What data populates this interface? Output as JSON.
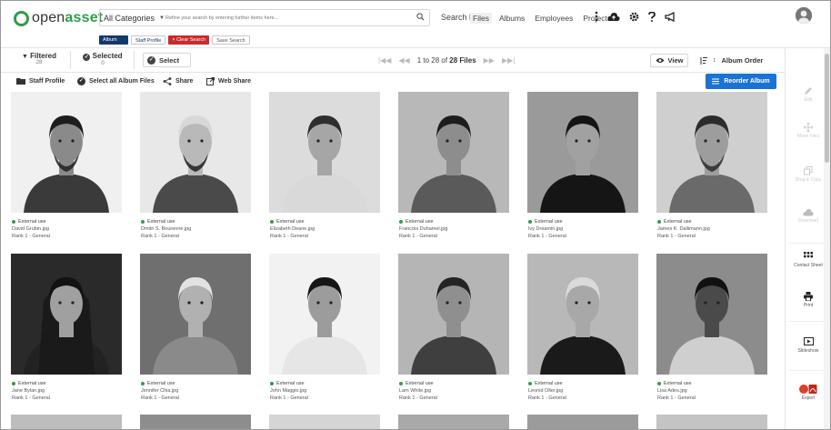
{
  "header": {
    "logo": {
      "brand_prefix": "open",
      "brand_suffix": "asset"
    },
    "category": "All Categories",
    "search_placeholder": "Refine your search by entering further items here...",
    "search_by": "Search by",
    "chips": [
      "Album",
      "Staff Profile",
      "× Clear Search",
      "Save Search"
    ],
    "nav": [
      "Files",
      "Albums",
      "Employees",
      "Projects"
    ],
    "nav_active": "Files"
  },
  "toolbar": {
    "filtered_label": "Filtered",
    "filtered_count": "28",
    "selected_label": "Selected",
    "selected_count": "0",
    "select_label": "Select",
    "pager_text": "1 to 28 of",
    "pager_bold": "28 Files",
    "view_label": "View",
    "order_label": "Album Order"
  },
  "actions": {
    "staff_profile": "Staff Profile",
    "select_all": "Select all Album Files",
    "share": "Share",
    "web_share": "Web Share",
    "reorder": "Reorder Album"
  },
  "sidebar": {
    "items": [
      {
        "label": "Edit",
        "icon": "pencil-icon",
        "dim": true
      },
      {
        "label": "Move Files",
        "icon": "move-icon",
        "dim": true
      },
      {
        "label": "Drag & Copy",
        "icon": "copy-icon",
        "dim": true
      },
      {
        "label": "Download",
        "icon": "cloud-download-icon",
        "dim": true
      },
      {
        "label": "Contact Sheet",
        "icon": "grid-icon",
        "dim": false
      },
      {
        "label": "Print",
        "icon": "print-icon",
        "dim": false
      },
      {
        "label": "Slideshow",
        "icon": "slideshow-icon",
        "dim": false
      },
      {
        "label": "Export",
        "icon": "export-icon",
        "dim": false
      }
    ]
  },
  "files": [
    {
      "usage": "External use",
      "name": "David Grubin.jpg",
      "rank": "Rank 1 - General"
    },
    {
      "usage": "External use",
      "name": "Dmitri S. Bourenne.jpg",
      "rank": "Rank 1 - General"
    },
    {
      "usage": "External use",
      "name": "Elizabeth Deane.jpg",
      "rank": "Rank 1 - General"
    },
    {
      "usage": "External use",
      "name": "Francois Duhamel.jpg",
      "rank": "Rank 1 - General"
    },
    {
      "usage": "External use",
      "name": "Ivy Dreamin.jpg",
      "rank": "Rank 1 - General"
    },
    {
      "usage": "External use",
      "name": "James K. Dallimann.jpg",
      "rank": "Rank 1 - General"
    },
    {
      "usage": "External use",
      "name": "Jane Bylan.jpg",
      "rank": "Rank 1 - General"
    },
    {
      "usage": "External use",
      "name": "Jennifer Chia.jpg",
      "rank": "Rank 1 - General"
    },
    {
      "usage": "External use",
      "name": "John Maggio.jpg",
      "rank": "Rank 1 - General"
    },
    {
      "usage": "External use",
      "name": "Lam White.jpg",
      "rank": "Rank 1 - General"
    },
    {
      "usage": "External use",
      "name": "Leonid Oller.jpg",
      "rank": "Rank 1 - General"
    },
    {
      "usage": "External use",
      "name": "Lisa Ades.jpg",
      "rank": "Rank 1 - General"
    }
  ],
  "colors": {
    "brand_green": "#2e9e48",
    "primary_blue": "#1a73d4",
    "chip_navy": "#14396b",
    "clear_red": "#c92a2a"
  }
}
